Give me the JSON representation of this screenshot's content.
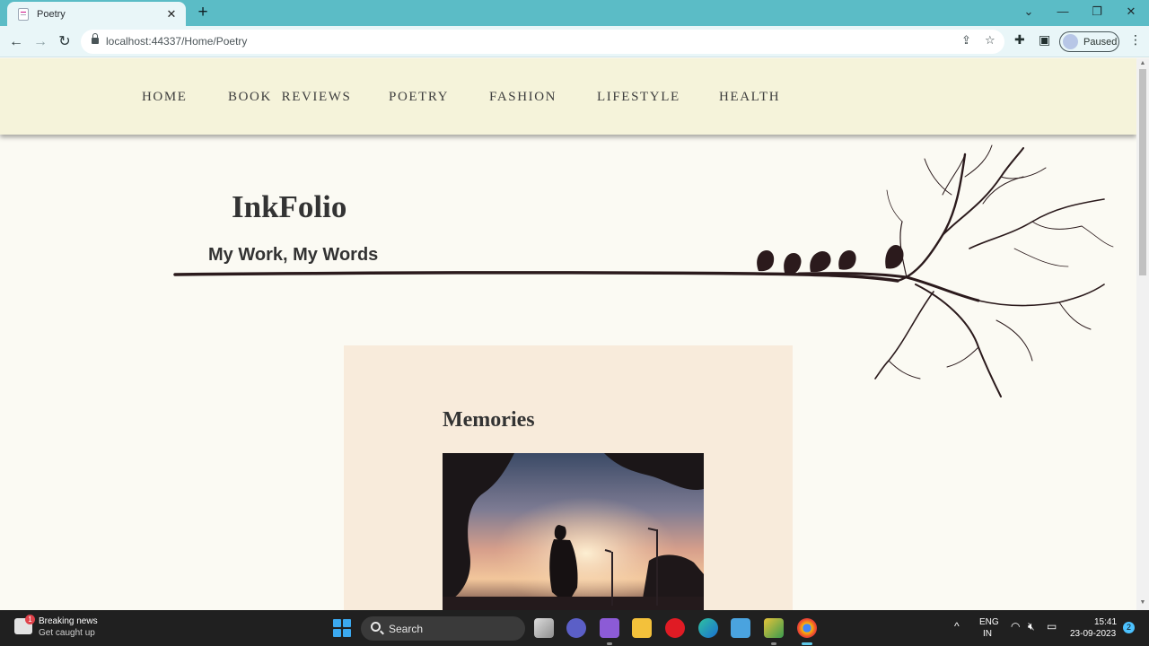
{
  "browser": {
    "tab": {
      "title": "Poetry",
      "close_glyph": "✕",
      "favicon": "page-icon"
    },
    "new_tab_glyph": "+",
    "window_controls": {
      "chevron": "⌄",
      "minimize": "—",
      "maximize": "❐",
      "close": "✕"
    },
    "nav": {
      "back": "←",
      "forward": "→",
      "reload": "↻"
    },
    "url": "localhost:44337/Home/Poetry",
    "omnibox_icons": {
      "share": "⇪",
      "bookmark": "☆"
    },
    "toolbar_icons": {
      "extensions": "✚",
      "side_panel": "▣",
      "menu": "⋮"
    },
    "profile_label": "Paused"
  },
  "site": {
    "nav_links": [
      "HOME",
      "BOOK  REVIEWS",
      "POETRY",
      "FASHION",
      "LIFESTYLE",
      "HEALTH"
    ],
    "brand": "InkFolio",
    "tagline": "My Work, My Words",
    "post": {
      "title": "Memories",
      "image": "silhouette-sunset-image"
    }
  },
  "taskbar": {
    "news": {
      "badge": "1",
      "title": "Breaking news",
      "subtitle": "Get caught up"
    },
    "search_label": "Search",
    "lang_top": "ENG",
    "lang_bottom": "IN",
    "time": "15:41",
    "date": "23-09-2023",
    "notification_count": "2",
    "tray_icons": {
      "chevron": "^",
      "wifi": "wifi-icon",
      "volume": "volume-muted-icon",
      "battery": "battery-icon"
    }
  },
  "colors": {
    "tabstrip": "#5bbcc6",
    "nav_bg": "#f5f3da",
    "page_bg": "#fbfaf3",
    "card_bg": "#f8ebdb",
    "branch": "#2b1a1c"
  }
}
